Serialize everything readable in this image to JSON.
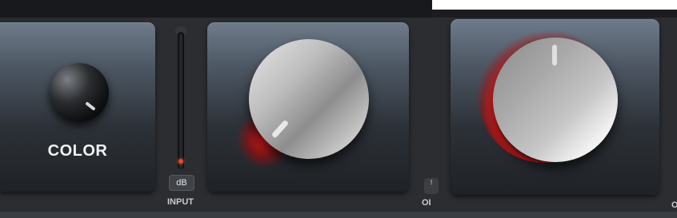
{
  "color_module": {
    "label": "COLOR"
  },
  "input_module": {
    "unit_button": "dB",
    "label": "INPUT"
  },
  "output_module": {
    "icon_glyph": "ꜝ",
    "label": "OI",
    "edge_label": "O"
  },
  "colors": {
    "accent_red": "#ff1e1e",
    "panel_top": "#6e7b8a",
    "panel_bottom": "#1f2226"
  },
  "icons": [
    "knob-indicator",
    "level-meter",
    "output-icon"
  ]
}
